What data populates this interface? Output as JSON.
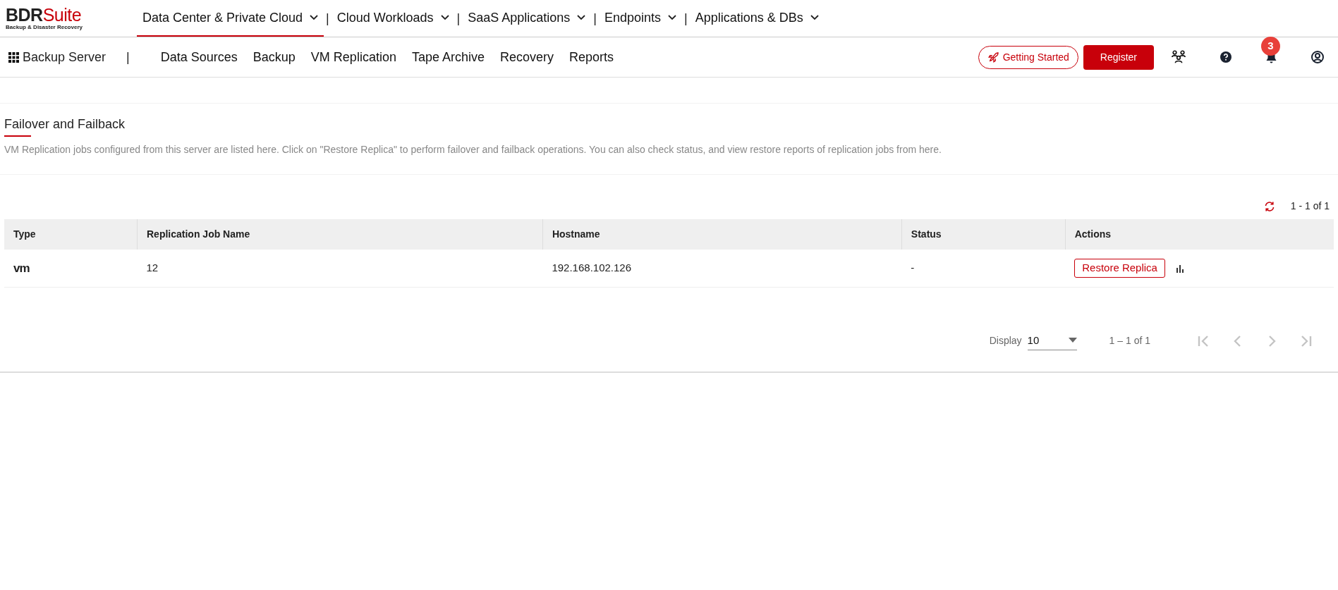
{
  "brand": {
    "name_dark": "BDR",
    "name_red": "Suite",
    "tagline": "Backup & Disaster Recovery"
  },
  "top_nav": [
    {
      "label": "Data Center & Private Cloud",
      "selected": true
    },
    {
      "label": "Cloud Workloads",
      "selected": false
    },
    {
      "label": "SaaS Applications",
      "selected": false
    },
    {
      "label": "Endpoints",
      "selected": false
    },
    {
      "label": "Applications & DBs",
      "selected": false
    }
  ],
  "separator": "|",
  "product": "Backup Server",
  "sub_nav": [
    "Data Sources",
    "Backup",
    "VM Replication",
    "Tape Archive",
    "Recovery",
    "Reports"
  ],
  "getting_started": "Getting Started",
  "register": "Register",
  "notification_count": "3",
  "page": {
    "title": "Failover and Failback",
    "description": "VM Replication jobs configured from this server are listed here. Click on \"Restore Replica\" to perform failover and failback operations. You can also check status, and view restore reports of replication jobs from here."
  },
  "table": {
    "range": "1 - 1 of 1",
    "columns": [
      "Type",
      "Replication Job Name",
      "Hostname",
      "Status",
      "Actions"
    ],
    "rows": [
      {
        "type": "vm",
        "name": "12",
        "hostname": "192.168.102.126",
        "status": "-",
        "action": "Restore Replica"
      }
    ]
  },
  "pagination": {
    "display_label": "Display",
    "page_size": "10",
    "range": "1 – 1 of 1",
    "first_disabled": true,
    "prev_disabled": true,
    "next_disabled": true,
    "last_disabled": true
  }
}
